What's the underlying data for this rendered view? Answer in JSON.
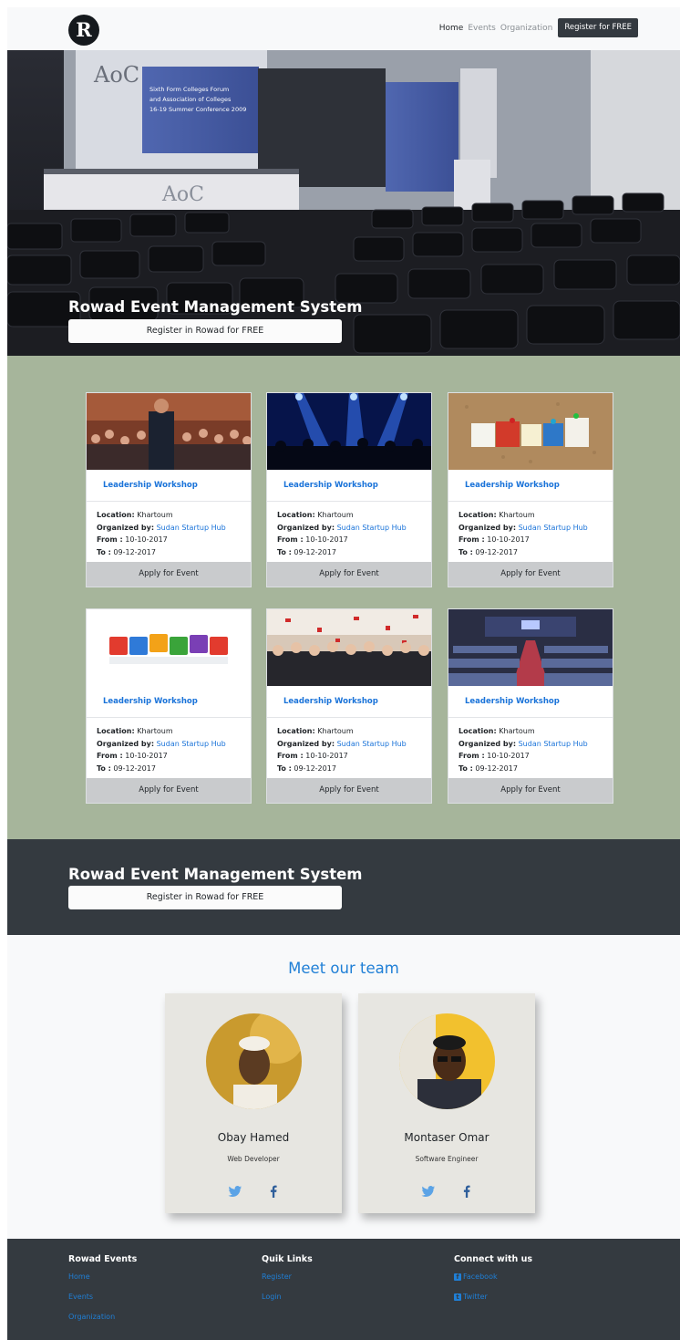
{
  "navbar": {
    "logo_letter": "R",
    "links": [
      "Home",
      "Events",
      "Organization"
    ],
    "register_label": "Register for FREE"
  },
  "hero": {
    "title": "Rowad Event Management System",
    "button_label": "Register in Rowad for FREE",
    "backdrop": {
      "logo_left": "AoC",
      "banner_text": [
        "Sixth Form Colleges Forum",
        "and Association of Colleges",
        "16-19 Summer Conference 2009"
      ],
      "podium_logo": "AoC"
    }
  },
  "events": {
    "cards": [
      {
        "image": "speaker-audience-photo",
        "title": "Leadership Workshop",
        "location_label": "Location:",
        "location": "Khartoum",
        "organized_label": "Organized by:",
        "organizer": "Sudan Startup Hub",
        "from_label": "From :",
        "from": "10-10-2017",
        "to_label": "To :",
        "to": "09-12-2017",
        "apply_label": "Apply for Event"
      },
      {
        "image": "concert-crowd-photo",
        "title": "Leadership Workshop",
        "location_label": "Location:",
        "location": "Khartoum",
        "organized_label": "Organized by:",
        "organizer": "Sudan Startup Hub",
        "from_label": "From :",
        "from": "10-10-2017",
        "to_label": "To :",
        "to": "09-12-2017",
        "apply_label": "Apply for Event"
      },
      {
        "image": "event-letters-corkboard-photo",
        "title": "Leadership Workshop",
        "location_label": "Location:",
        "location": "Khartoum",
        "organized_label": "Organized by:",
        "organizer": "Sudan Startup Hub",
        "from_label": "From :",
        "from": "10-10-2017",
        "to_label": "To :",
        "to": "09-12-2017",
        "apply_label": "Apply for Event"
      },
      {
        "image": "events-blocks-photo",
        "title": "Leadership Workshop",
        "location_label": "Location:",
        "location": "Khartoum",
        "organized_label": "Organized by:",
        "organizer": "Sudan Startup Hub",
        "from_label": "From :",
        "from": "10-10-2017",
        "to_label": "To :",
        "to": "09-12-2017",
        "apply_label": "Apply for Event"
      },
      {
        "image": "party-group-photo",
        "title": "Leadership Workshop",
        "location_label": "Location:",
        "location": "Khartoum",
        "organized_label": "Organized by:",
        "organizer": "Sudan Startup Hub",
        "from_label": "From :",
        "from": "10-10-2017",
        "to_label": "To :",
        "to": "09-12-2017",
        "apply_label": "Apply for Event"
      },
      {
        "image": "conference-hall-photo",
        "title": "Leadership Workshop",
        "location_label": "Location:",
        "location": "Khartoum",
        "organized_label": "Organized by:",
        "organizer": "Sudan Startup Hub",
        "from_label": "From :",
        "from": "10-10-2017",
        "to_label": "To :",
        "to": "09-12-2017",
        "apply_label": "Apply for Event"
      }
    ]
  },
  "cta": {
    "title": "Rowad Event Management System",
    "button_label": "Register in Rowad for FREE"
  },
  "team": {
    "title": "Meet our team",
    "members": [
      {
        "name": "Obay Hamed",
        "role": "Web Developer"
      },
      {
        "name": "Montaser Omar",
        "role": "Software Engineer"
      }
    ]
  },
  "footer": {
    "columns": [
      {
        "heading": "Rowad Events",
        "links": [
          "Home",
          "Events",
          "Organization"
        ]
      },
      {
        "heading": "Quik Links",
        "links": [
          "Register",
          "Login"
        ]
      },
      {
        "heading": "Connect with us",
        "links": [
          "Facebook",
          "Twitter"
        ]
      }
    ]
  },
  "colors": {
    "dark": "#343a40",
    "events_bg": "#a6b59b",
    "link_blue": "#1a73d9",
    "team_title": "#1f7fd6",
    "light": "#f8f9fa"
  }
}
